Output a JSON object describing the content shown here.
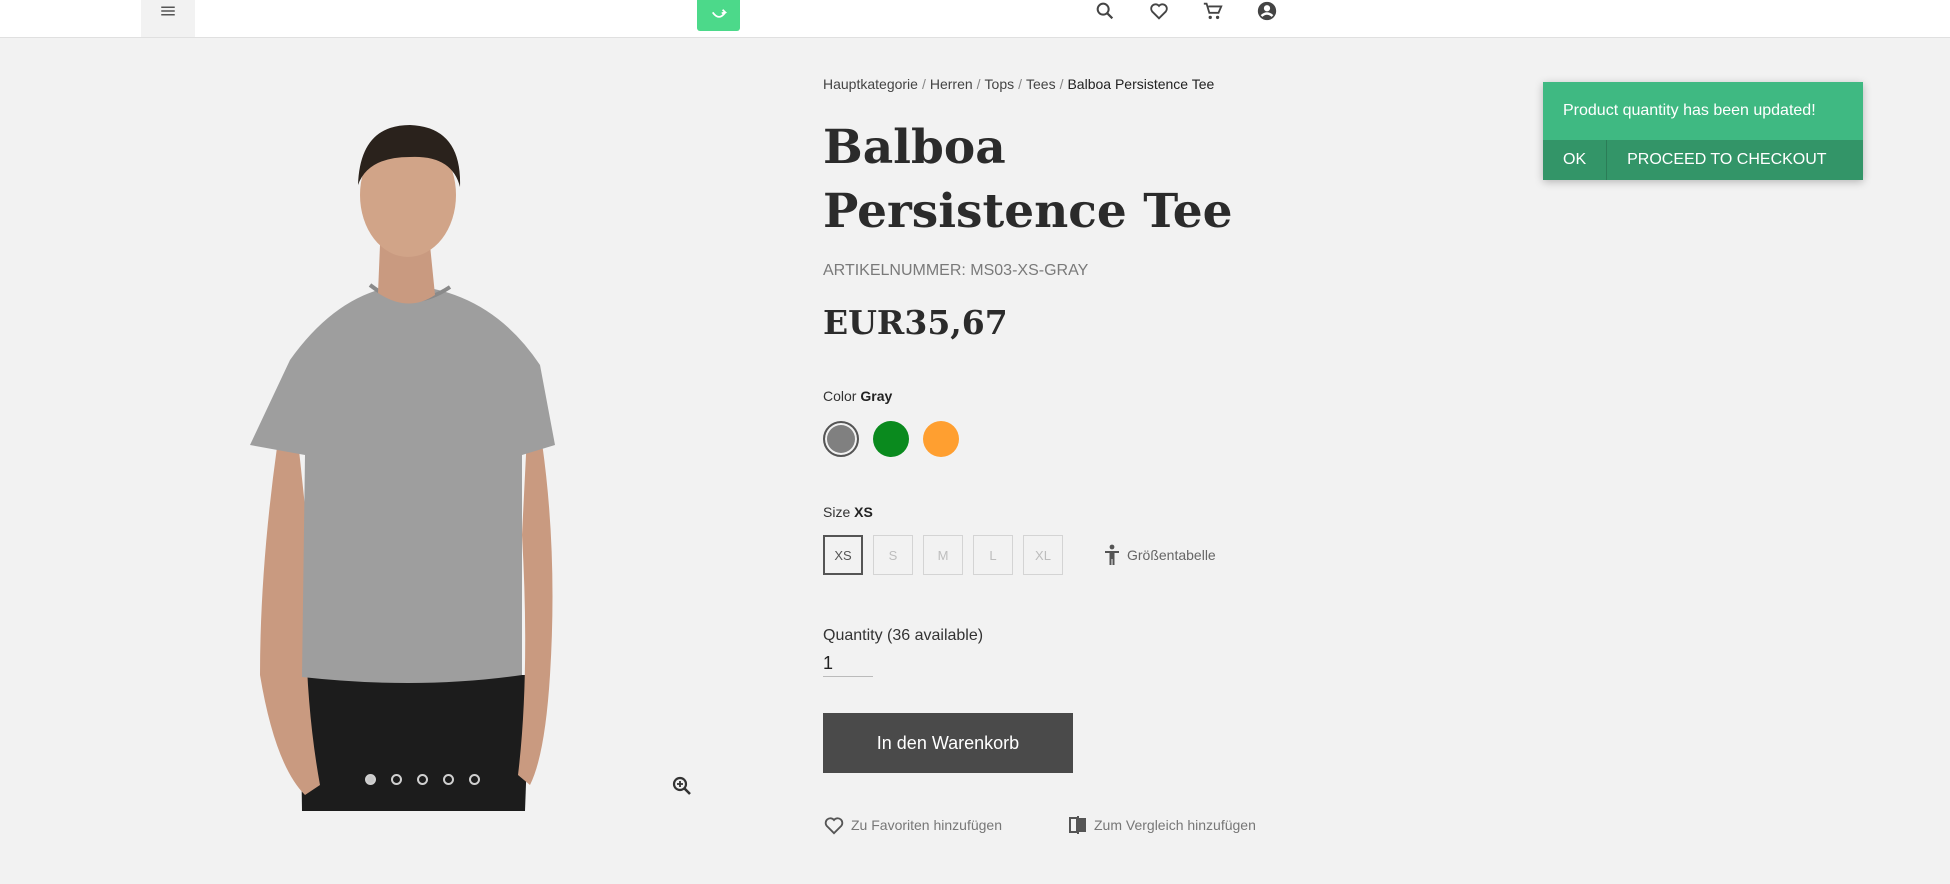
{
  "header": {
    "menu_icon": "hamburger-icon",
    "logo_icon": "shopping-bag-icon",
    "icons": [
      "search-icon",
      "heart-icon",
      "cart-icon",
      "account-icon"
    ]
  },
  "gallery": {
    "image_alt": "Balboa Persistence Tee product photo",
    "dots": 5,
    "active_dot": 0,
    "zoom_icon": "zoom-in-icon"
  },
  "breadcrumb": {
    "items": [
      "Hauptkategorie",
      "Herren",
      "Tops",
      "Tees"
    ],
    "current": "Balboa Persistence Tee",
    "separator": "/"
  },
  "product": {
    "title": "Balboa Persistence Tee",
    "sku": "ARTIKELNUMMER: MS03-XS-GRAY",
    "price": "EUR35,67"
  },
  "color": {
    "label": "Color",
    "selected": "Gray",
    "swatches": [
      {
        "name": "Gray",
        "hex": "#808080",
        "selected": true
      },
      {
        "name": "Green",
        "hex": "#0a8a1e",
        "selected": false
      },
      {
        "name": "Orange",
        "hex": "#ff9f30",
        "selected": false
      }
    ]
  },
  "size": {
    "label": "Size",
    "selected": "XS",
    "options": [
      "XS",
      "S",
      "M",
      "L",
      "XL"
    ],
    "size_chart_label": "Größentabelle"
  },
  "quantity": {
    "label": "Quantity (36 available)",
    "value": "1"
  },
  "add_to_cart": {
    "label": "In den Warenkorb"
  },
  "actions": {
    "favorites": "Zu Favoriten hinzufügen",
    "compare": "Zum Vergleich hinzufügen"
  },
  "notification": {
    "message": "Product quantity has been updated!",
    "ok": "OK",
    "checkout": "PROCEED TO CHECKOUT"
  },
  "colors": {
    "notify_bg": "#3fb982",
    "notify_actions_bg": "#339568",
    "button_dark": "#4a4a4a",
    "logo_green": "#4cd98a"
  }
}
